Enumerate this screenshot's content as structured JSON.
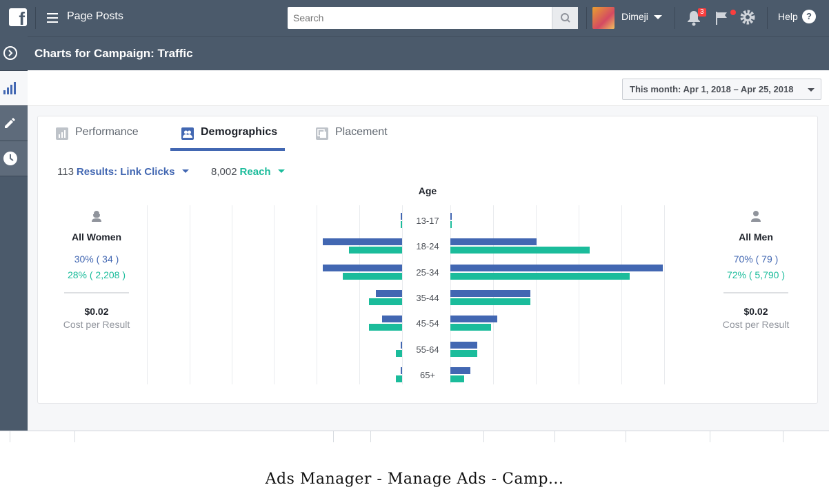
{
  "topbar": {
    "logo_letter": "f",
    "title": "Page Posts",
    "search_placeholder": "Search",
    "user_name": "Dimeji",
    "notification_count": "3",
    "help_label": "Help"
  },
  "header": {
    "title": "Charts for Campaign: Traffic"
  },
  "date_range": "This month: Apr 1, 2018 – Apr 25, 2018",
  "tabs": [
    {
      "label": "Performance",
      "active": false
    },
    {
      "label": "Demographics",
      "active": true
    },
    {
      "label": "Placement",
      "active": false
    }
  ],
  "metrics": {
    "results_value": "113",
    "results_label": "Results: Link Clicks",
    "reach_value": "8,002",
    "reach_label": "Reach"
  },
  "women": {
    "label": "All Women",
    "results_pct": "30% ( 34 )",
    "reach_pct": "28% ( 2,208 )",
    "cost": "$0.02",
    "cost_label": "Cost per Result"
  },
  "men": {
    "label": "All Men",
    "results_pct": "70% ( 79 )",
    "reach_pct": "72% ( 5,790 )",
    "cost": "$0.02",
    "cost_label": "Cost per Result"
  },
  "colors": {
    "results": "#4267b2",
    "reach": "#1bbc9b",
    "topbar": "#4b5a6b"
  },
  "chart_data": {
    "type": "bar",
    "title": "Age",
    "categories": [
      "13-17",
      "18-24",
      "25-34",
      "35-44",
      "45-54",
      "55-64",
      "65+"
    ],
    "series": [
      {
        "name": "Results: Link Clicks",
        "side": "women",
        "values": [
          0.01,
          0.75,
          0.75,
          0.25,
          0.19,
          0.01,
          0.01
        ]
      },
      {
        "name": "Reach",
        "side": "women",
        "values": [
          0.01,
          0.5,
          0.56,
          0.31,
          0.31,
          0.06,
          0.06
        ]
      },
      {
        "name": "Results: Link Clicks",
        "side": "men",
        "values": [
          0.01,
          0.81,
          2.0,
          0.75,
          0.44,
          0.25,
          0.19
        ]
      },
      {
        "name": "Reach",
        "side": "men",
        "values": [
          0.01,
          1.31,
          1.69,
          0.75,
          0.38,
          0.25,
          0.13
        ]
      }
    ]
  },
  "footer_caption": "Ads Manager - Manage Ads - Camp..."
}
